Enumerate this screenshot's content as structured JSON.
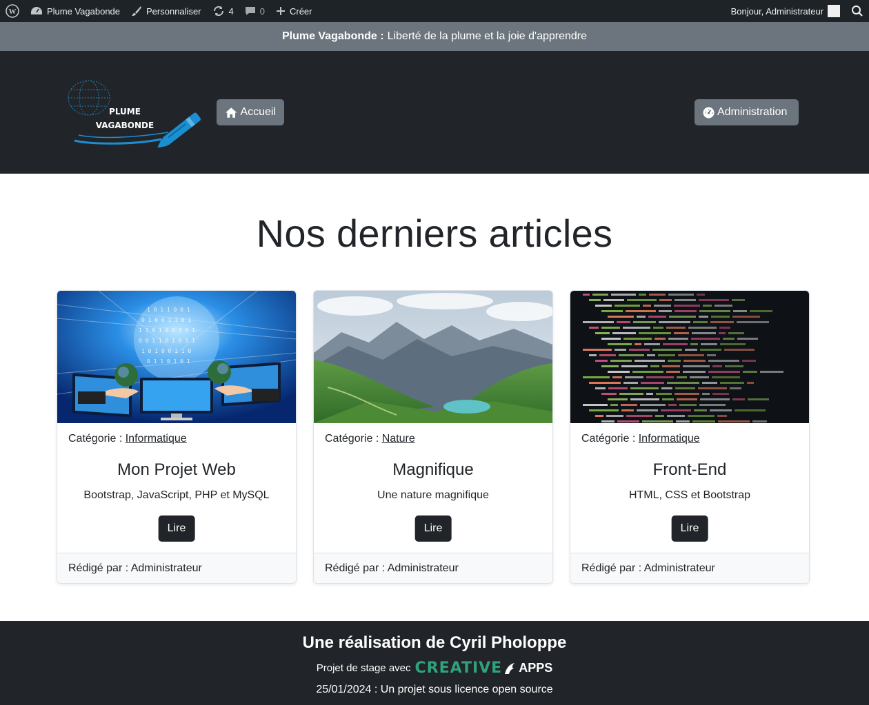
{
  "adminbar": {
    "site_name": "Plume Vagabonde",
    "customize": "Personnaliser",
    "updates_count": "4",
    "comments_count": "0",
    "create": "Créer",
    "greeting": "Bonjour, Administrateur"
  },
  "tagline": {
    "site": "Plume Vagabonde :",
    "text": "Liberté de la plume et la joie d'apprendre"
  },
  "header": {
    "logo_line1": "PLUME",
    "logo_line2": "VAGABONDE",
    "home_label": "Accueil",
    "admin_label": "Administration"
  },
  "main": {
    "title": "Nos derniers articles",
    "articles": [
      {
        "category_prefix": "Catégorie :",
        "category": "Informatique",
        "title": "Mon Projet Web",
        "excerpt": "Bootstrap, JavaScript, PHP et MySQL",
        "read_label": "Lire",
        "author": "Rédigé par : Administrateur",
        "image": "digital-globe-hands-screens"
      },
      {
        "category_prefix": "Catégorie :",
        "category": "Nature",
        "title": "Magnifique",
        "excerpt": "Une nature magnifique",
        "read_label": "Lire",
        "author": "Rédigé par : Administrateur",
        "image": "mountain-lake-landscape"
      },
      {
        "category_prefix": "Catégorie :",
        "category": "Informatique",
        "title": "Front-End",
        "excerpt": "HTML, CSS et Bootstrap",
        "read_label": "Lire",
        "author": "Rédigé par : Administrateur",
        "image": "html-source-code-screen"
      }
    ]
  },
  "footer": {
    "title": "Une réalisation de Cyril Pholoppe",
    "stage_prefix": "Projet de stage avec",
    "brand_creative": "CREATIVE",
    "brand_apps": "APPS",
    "date_line": "25/01/2024 : Un projet sous licence open source"
  },
  "colors": {
    "adminbar_bg": "#1d2327",
    "tagline_bg": "#6c757d",
    "header_bg": "#212529",
    "logo_blue": "#1b8fd1",
    "brand_green": "#2fa37a"
  }
}
